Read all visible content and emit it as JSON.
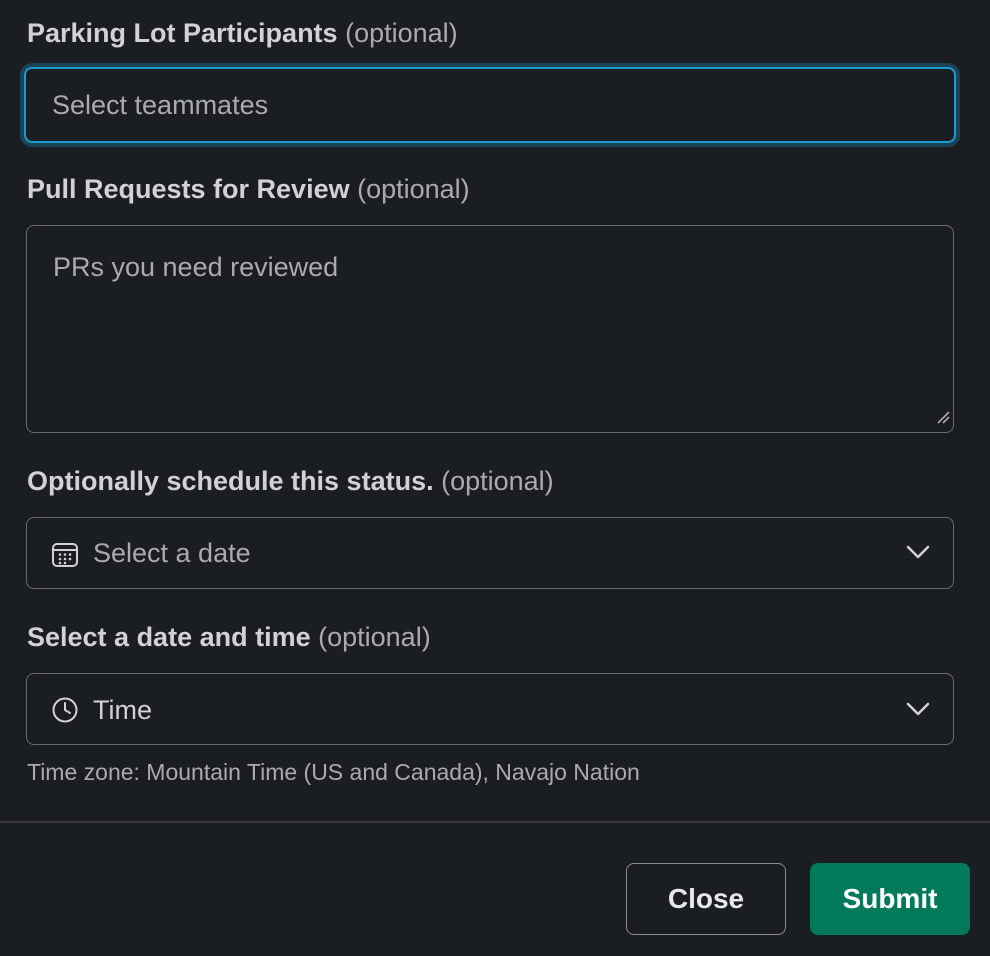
{
  "fields": {
    "participants": {
      "label": "Parking Lot Participants",
      "optional": "(optional)",
      "placeholder": "Select teammates"
    },
    "pull_requests": {
      "label": "Pull Requests for Review",
      "optional": "(optional)",
      "placeholder": "PRs you need reviewed"
    },
    "schedule": {
      "label": "Optionally schedule this status.",
      "optional": "(optional)",
      "placeholder": "Select a date",
      "icon": "calendar-icon"
    },
    "datetime": {
      "label": "Select a date and time",
      "optional": "(optional)",
      "value": "Time",
      "icon": "clock-icon",
      "helper": "Time zone: Mountain Time (US and Canada), Navajo Nation"
    }
  },
  "footer": {
    "close_label": "Close",
    "submit_label": "Submit"
  },
  "colors": {
    "background": "#1a1d21",
    "focus": "#1d9bd1",
    "submit": "#007a5a"
  }
}
